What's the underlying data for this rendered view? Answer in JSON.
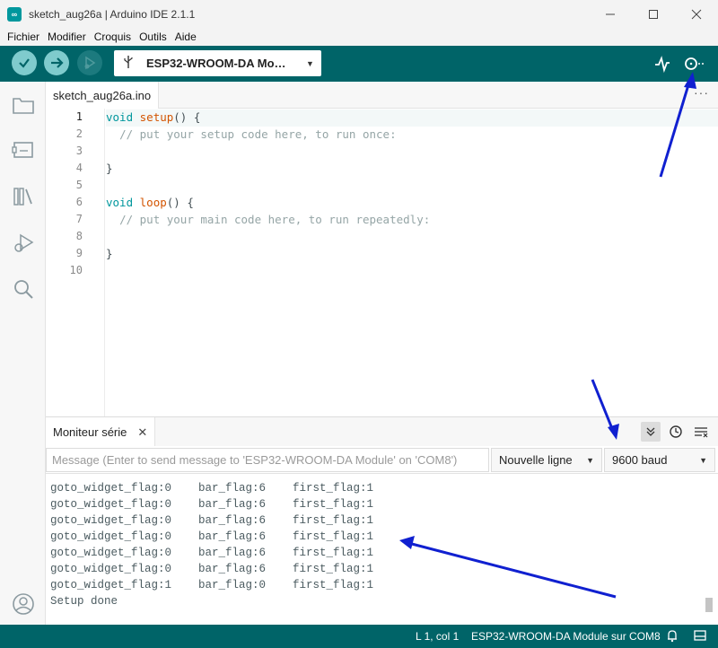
{
  "window": {
    "title": "sketch_aug26a | Arduino IDE 2.1.1",
    "controls": [
      "minimize",
      "maximize",
      "close"
    ]
  },
  "menubar": {
    "items": [
      "Fichier",
      "Modifier",
      "Croquis",
      "Outils",
      "Aide"
    ]
  },
  "toolbar": {
    "board": "ESP32-WROOM-DA Mo…",
    "icons": [
      "verify-icon",
      "upload-icon",
      "debug-icon",
      "serial-plotter-icon",
      "serial-monitor-icon"
    ]
  },
  "editor": {
    "tab": "sketch_aug26a.ino",
    "lines": [
      {
        "no": "1",
        "parts": [
          {
            "t": "void",
            "c": "kw"
          },
          {
            "t": " "
          },
          {
            "t": "setup",
            "c": "fn"
          },
          {
            "t": "() {"
          }
        ]
      },
      {
        "no": "2",
        "parts": [
          {
            "t": "  "
          },
          {
            "t": "// put your setup code here, to run once:",
            "c": "cm"
          }
        ]
      },
      {
        "no": "3",
        "parts": []
      },
      {
        "no": "4",
        "parts": [
          {
            "t": "}"
          }
        ]
      },
      {
        "no": "5",
        "parts": []
      },
      {
        "no": "6",
        "parts": [
          {
            "t": "void",
            "c": "kw"
          },
          {
            "t": " "
          },
          {
            "t": "loop",
            "c": "fn"
          },
          {
            "t": "() {"
          }
        ]
      },
      {
        "no": "7",
        "parts": [
          {
            "t": "  "
          },
          {
            "t": "// put your main code here, to run repeatedly:",
            "c": "cm"
          }
        ]
      },
      {
        "no": "8",
        "parts": []
      },
      {
        "no": "9",
        "parts": [
          {
            "t": "}"
          }
        ]
      },
      {
        "no": "10",
        "parts": []
      }
    ]
  },
  "serial_monitor": {
    "tab_label": "Moniteur série",
    "input_placeholder": "Message (Enter to send message to 'ESP32-WROOM-DA Module' on 'COM8')",
    "line_ending": "Nouvelle ligne",
    "baud_rate": "9600 baud",
    "output": [
      "goto_widget_flag:0    bar_flag:6    first_flag:1",
      "goto_widget_flag:0    bar_flag:6    first_flag:1",
      "goto_widget_flag:0    bar_flag:6    first_flag:1",
      "goto_widget_flag:0    bar_flag:6    first_flag:1",
      "goto_widget_flag:0    bar_flag:6    first_flag:1",
      "goto_widget_flag:0    bar_flag:6    first_flag:1",
      "goto_widget_flag:1    bar_flag:0    first_flag:1",
      "Setup done"
    ]
  },
  "statusbar": {
    "cursor": "L 1, col 1",
    "board_port": "ESP32-WROOM-DA Module sur COM8"
  },
  "colors": {
    "toolbar": "#006468",
    "accent": "#00979d",
    "annotation": "#1020d0"
  }
}
